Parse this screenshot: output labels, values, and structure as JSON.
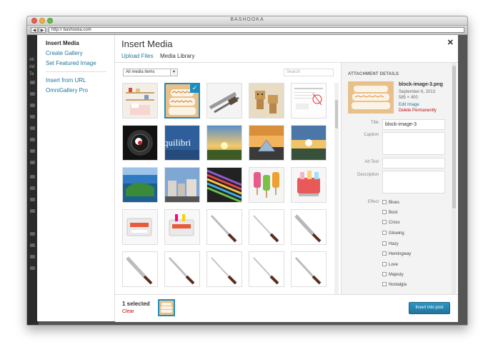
{
  "window": {
    "title": "BASHOOKA",
    "url": "http:// bashooka.com",
    "back_label": "◀",
    "forward_label": "▶"
  },
  "wp_admin": {
    "labels": [
      "All",
      "Ad",
      "Ta"
    ]
  },
  "sidebar": {
    "items": [
      {
        "label": "Insert Media",
        "active": true
      },
      {
        "label": "Create Gallery"
      },
      {
        "label": "Set Featured Image"
      },
      {
        "label": "Insert from URL"
      },
      {
        "label": "OmniGallery Pro"
      }
    ]
  },
  "frame": {
    "title": "Insert Media",
    "close_label": "✕",
    "tabs": [
      {
        "label": "Upload Files"
      },
      {
        "label": "Media Library",
        "active": true
      }
    ]
  },
  "toolbar": {
    "filter_value": "All media items",
    "filter_caret": "▾",
    "search_placeholder": "Search"
  },
  "grid": {
    "selected_index": 1,
    "check_label": "✓",
    "items": [
      "room-shelves",
      "pillows",
      "pliers-tool",
      "cardboard-robots",
      "document-sketch",
      "camera-lens",
      "equilibrium-text",
      "sunset-field",
      "louvre-pyramid",
      "sunset-clouds",
      "coast-island",
      "city-street",
      "stripes-lines",
      "ice-pops",
      "ice-pop-maker",
      "ice-pop-maker",
      "ice-pop-maker",
      "knife",
      "knife",
      "knife",
      "knife",
      "knife",
      "knife",
      "knife",
      "knife"
    ],
    "equilibrium_label": "quilibri"
  },
  "details": {
    "heading": "ATTACHMENT DETAILS",
    "filename": "block-image-3.png",
    "date": "September 6, 2013",
    "dimensions": "585 × 400",
    "edit_label": "Edit Image",
    "delete_label": "Delete Permanently",
    "fields": {
      "title_label": "Title",
      "title_value": "block-image-3",
      "caption_label": "Caption",
      "alt_label": "Alt Text",
      "description_label": "Description",
      "effect_label": "Effect"
    },
    "effects": [
      "Blues",
      "Boot",
      "Cross",
      "Glowing",
      "Hazy",
      "Hemingway",
      "Love",
      "Majesty",
      "Nostalgia"
    ]
  },
  "footer": {
    "selected_text": "1 selected",
    "clear_label": "Clear",
    "insert_label": "Insert into post"
  },
  "colors": {
    "accent": "#21759b",
    "selection": "#1e8cbe",
    "danger": "#bc0b0b"
  }
}
